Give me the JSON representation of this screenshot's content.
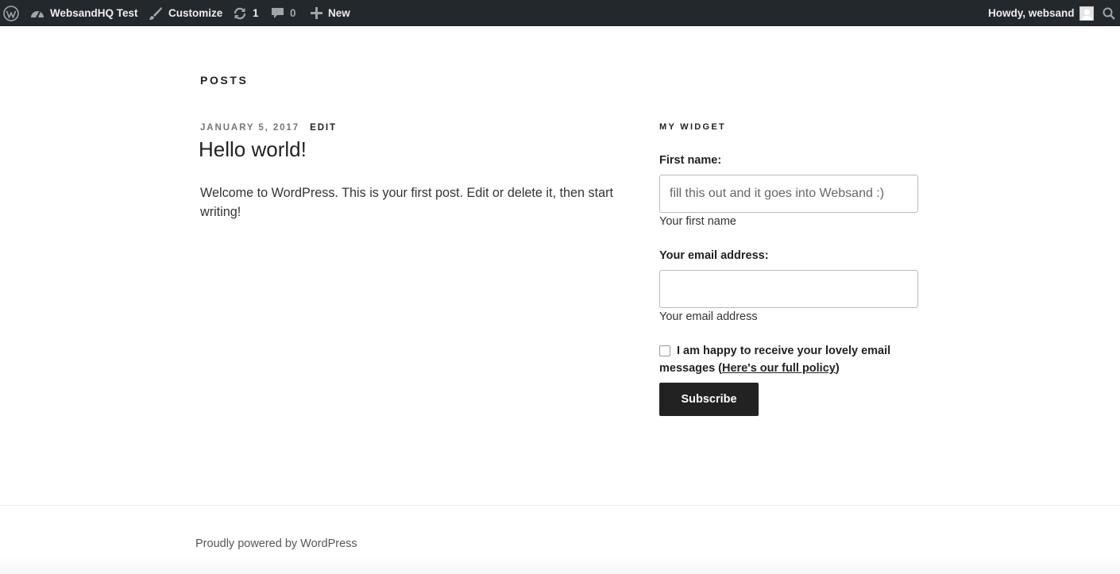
{
  "admin_bar": {
    "site_name": "WebsandHQ Test",
    "customize_label": "Customize",
    "updates_count": "1",
    "comments_count": "0",
    "new_label": "New",
    "greeting": "Howdy, websand",
    "icons": [
      "wordpress-icon",
      "dashboard-icon",
      "brush-icon",
      "updates-icon",
      "comment-icon",
      "plus-icon",
      "avatar",
      "search-icon"
    ]
  },
  "page": {
    "heading": "Posts"
  },
  "post": {
    "date": "January 5, 2017",
    "edit_label": "Edit",
    "title": "Hello world!",
    "body": "Welcome to WordPress. This is your first post. Edit or delete it, then start writing!"
  },
  "widget": {
    "title": "My Widget",
    "first_name_label": "First name:",
    "first_name_placeholder": "fill this out and it goes into Websand :)",
    "first_name_help": "Your first name",
    "email_label": "Your email address:",
    "email_value": "",
    "email_help": "Your email address",
    "consent_text": "I am happy to receive your lovely email messages (",
    "consent_link": "Here's our full policy",
    "consent_close": ")",
    "consent_checked": false,
    "subscribe_label": "Subscribe"
  },
  "footer": {
    "text": "Proudly powered by WordPress"
  },
  "colors": {
    "admin_bar_bg": "#23282d",
    "button_bg": "#222222",
    "text": "#222222"
  }
}
